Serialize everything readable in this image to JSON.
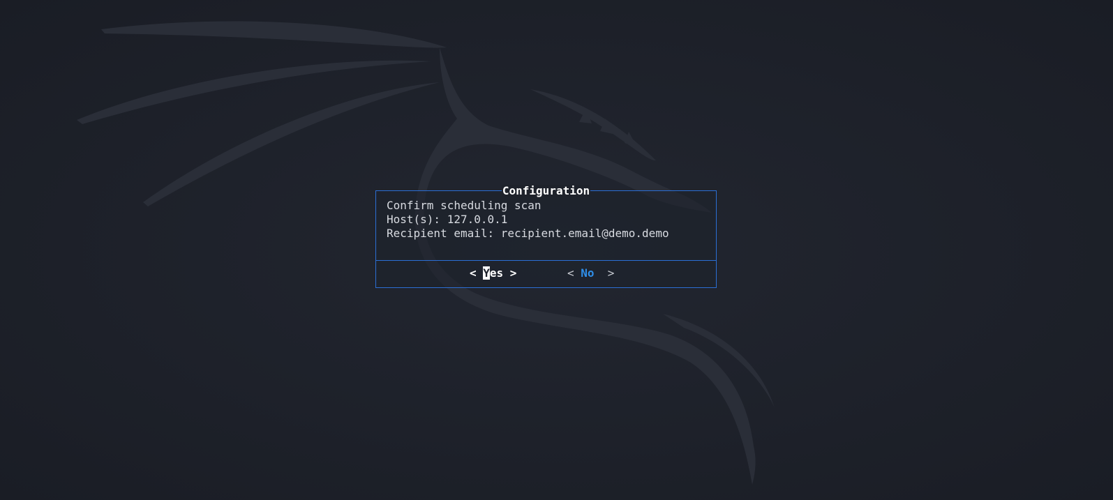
{
  "dialog": {
    "title": "Configuration",
    "lines": [
      "Confirm scheduling scan",
      "Host(s): 127.0.0.1",
      "Recipient email: recipient.email@demo.demo"
    ],
    "buttons": {
      "yes": {
        "left_bracket": "< ",
        "hotkey": "Y",
        "rest": "es",
        "right_bracket": " >"
      },
      "no": {
        "left_bracket": "< ",
        "label": "No",
        "right_bracket": "  >"
      }
    }
  },
  "colors": {
    "background": "#1e222b",
    "border_accent": "#2b6fd6",
    "no_label": "#2f8ee8",
    "dragon_logo": "#2a2e38"
  },
  "background": {
    "logo": "kali-dragon-icon"
  }
}
